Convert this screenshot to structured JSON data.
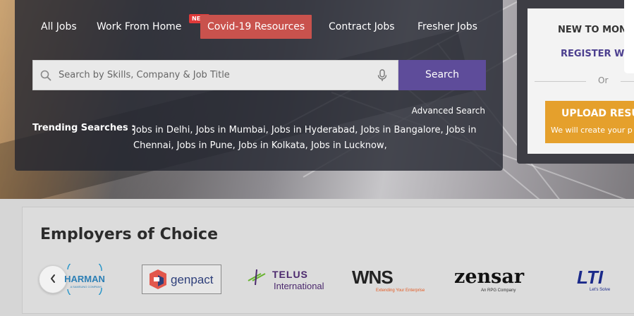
{
  "nav": {
    "tabs": [
      {
        "label": "All Jobs"
      },
      {
        "label": "Work From Home",
        "badge": "NEW"
      },
      {
        "label": "Covid-19 Resources",
        "active": true
      },
      {
        "label": "Contract Jobs"
      },
      {
        "label": "Fresher Jobs"
      }
    ]
  },
  "search": {
    "placeholder": "Search by Skills, Company & Job Title",
    "button_label": "Search",
    "advanced_label": "Advanced Search"
  },
  "trending": {
    "label": "Trending Searches :",
    "items": [
      "Jobs in Delhi,",
      "Jobs in Mumbai,",
      "Jobs in Hyderabad,",
      "Jobs in Bangalore,",
      "Jobs in Chennai,",
      "Jobs in Pune,",
      "Jobs in Kolkata,",
      "Jobs in Lucknow,"
    ]
  },
  "register": {
    "heading": "NEW TO MONS",
    "register_label": "REGISTER WIT",
    "or_label": "Or",
    "upload_label": "UPLOAD RESUM",
    "upload_sub": "We will create your p"
  },
  "employers": {
    "title": "Employers of Choice",
    "logos": [
      {
        "name": "HARMAN",
        "sub": "A SAMSUNG COMPANY"
      },
      {
        "name": "genpact"
      },
      {
        "name": "TELUS",
        "sub": "International"
      },
      {
        "name": "WNS",
        "sub": "Extending Your Enterprise"
      },
      {
        "name": "zensar",
        "sub": "An RPG Company"
      },
      {
        "name": "LTI",
        "sub": "Let's Solve"
      }
    ]
  },
  "colors": {
    "accent_purple": "#5e4c9a",
    "covid_tab": "#c9524d",
    "upload_orange": "#e5a02c",
    "new_badge": "#e03a3a"
  }
}
